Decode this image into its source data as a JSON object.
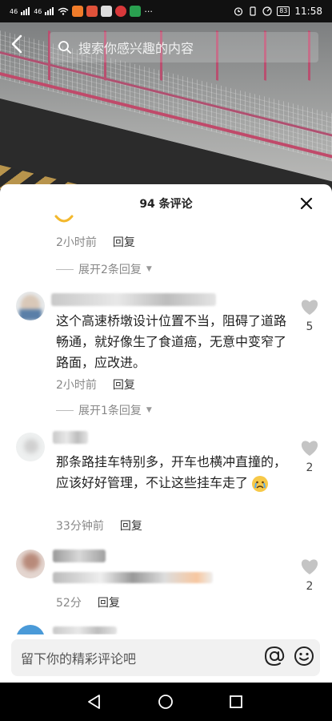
{
  "status_bar": {
    "signal1": "46",
    "signal2": "46",
    "battery": "83",
    "time": "11:58",
    "more": "···"
  },
  "search": {
    "placeholder": "搜索你感兴趣的内容"
  },
  "sheet": {
    "title": "94 条评论"
  },
  "comments": [
    {
      "time": "2小时前",
      "reply_label": "回复",
      "expand_label": "展开2条回复"
    },
    {
      "text": "这个高速桥墩设计位置不当，阻碍了道路畅通，就好像生了食道癌，无意中变窄了路面，应改进。",
      "time": "2小时前",
      "reply_label": "回复",
      "likes": "5",
      "expand_label": "展开1条回复"
    },
    {
      "text": "那条路挂车特别多，开车也横冲直撞的，应该好好管理，不让这些挂车走了",
      "time": "33分钟前",
      "reply_label": "回复",
      "likes": "2"
    },
    {
      "time_partial": "52分",
      "reply_label": "回复",
      "likes": "2"
    }
  ],
  "input": {
    "placeholder": "留下你的精彩评论吧"
  },
  "colors": {
    "sheet_bg": "#ffffff",
    "input_bg": "#f1f1f1",
    "accent_rail": "#c04a6a"
  }
}
